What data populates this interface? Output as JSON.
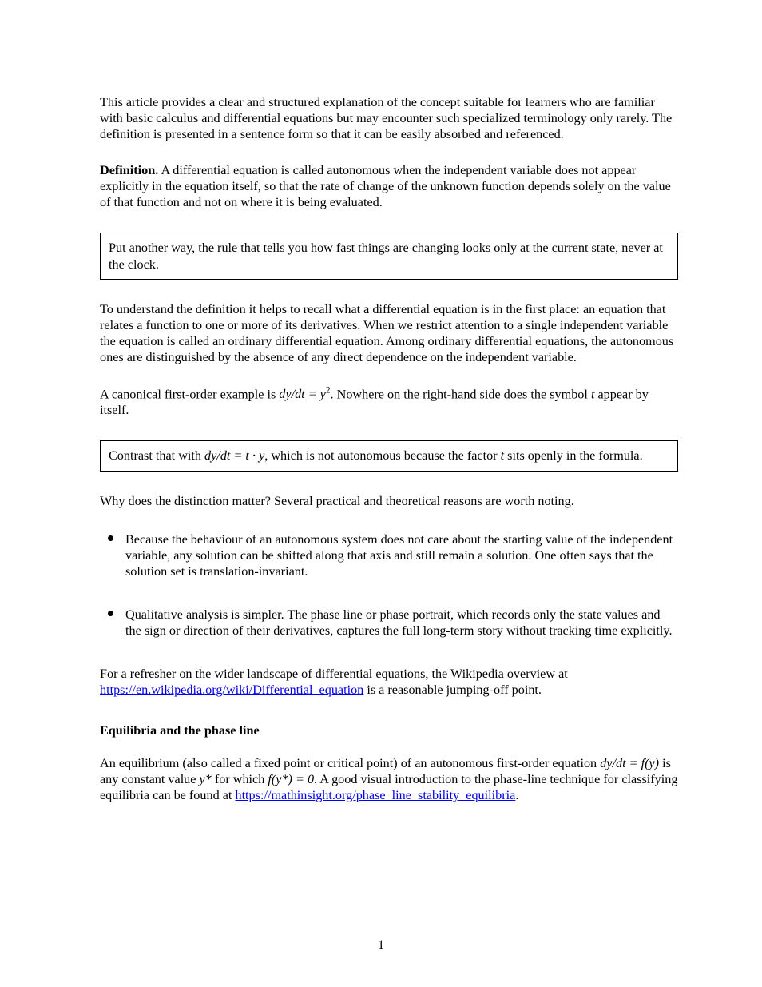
{
  "intro": {
    "p1": "This article provides a clear and structured explanation of the concept suitable for learners who are familiar with basic calculus and differential equations but may encounter such specialized terminology only rarely. The definition is presented in a sentence form so that it can be easily absorbed and referenced.",
    "definition_label": "Definition.",
    "definition_body": " A differential equation is called autonomous when the independent variable does not appear explicitly in the equation itself, so that the rate of change of the unknown function depends solely on the value of that function and not on where it is being evaluated.",
    "box1": "Put another way, the rule that tells you how fast things are changing looks only at the current state, never at the clock.",
    "p2": "To understand the definition it helps to recall what a differential equation is in the first place: an equation that relates a function to one or more of its derivatives. When we restrict attention to a single independent variable the equation is called an ordinary differential equation. Among ordinary differential equations, the autonomous ones are distinguished by the absence of any direct dependence on the independent variable.",
    "p3_prefix": "A canonical first-order example is ",
    "p3_eq": "dy/dt = y²",
    "p3_suffix": ". Nowhere on the right-hand side does the symbol ",
    "p3_t": "t",
    "p3_end": " appear by itself.",
    "box2_prefix": "Contrast that with ",
    "box2_eq": "dy/dt = t · y",
    "box2_mid": ", which is not autonomous because the factor ",
    "box2_t": "t",
    "box2_suffix": " sits openly in the formula.",
    "p4": "Why does the distinction matter? Several practical and theoretical reasons are worth noting.",
    "bullets": [
      "Because the behaviour of an autonomous system does not care about the starting value of the independent variable, any solution can be shifted along that axis and still remain a solution. One often says that the solution set is translation-invariant.",
      "Qualitative analysis is simpler. The phase line or phase portrait, which records only the state values and the sign or direction of their derivatives, captures the full long-term story without tracking time explicitly."
    ],
    "p5_prefix": "For a refresher on the wider landscape of differential equations, the Wikipedia overview at ",
    "p5_link": "https://en.wikipedia.org/wiki/Differential_equation",
    "p5_suffix": " is a reasonable jumping-off point.",
    "transition_heading": "Equilibria and the phase line",
    "p6_prefix": "An equilibrium (also called a fixed point or critical point) of an autonomous first-order equation ",
    "p6_eq1": "dy/dt = f(y)",
    "p6_mid": " is any constant value ",
    "p6_eq2": "y*",
    "p6_mid2": " for which ",
    "p6_eq3": "f(y*) = 0",
    "p6_suffix": ". A good visual introduction to the phase-line technique for classifying equilibria can be found at ",
    "p6_link": "https://mathinsight.org/phase_line_stability_equilibria",
    "p6_end": "."
  },
  "page_number": "1"
}
